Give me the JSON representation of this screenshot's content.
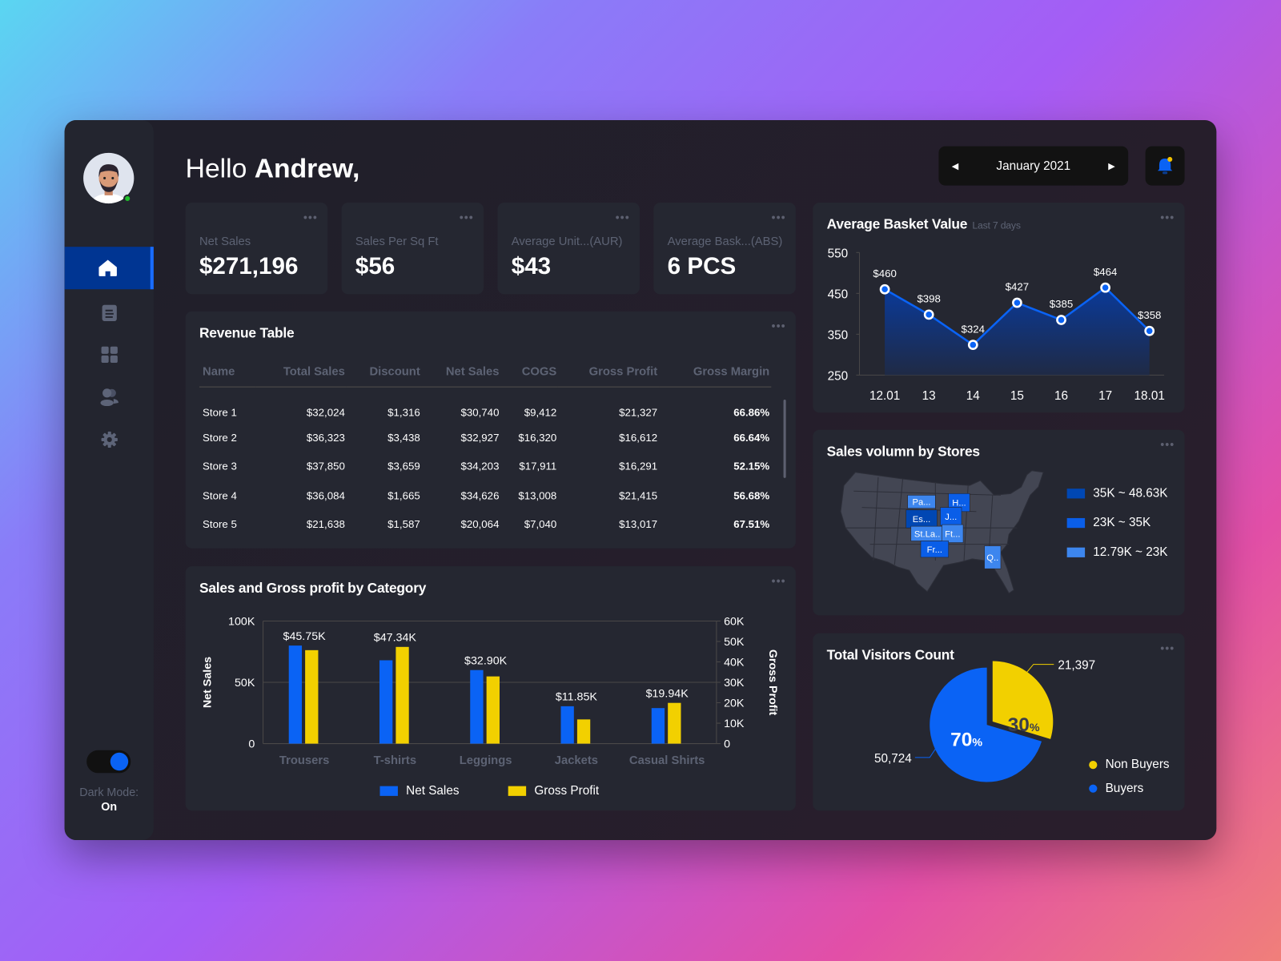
{
  "greeting": {
    "hello": "Hello",
    "name": "Andrew,"
  },
  "date_picker": {
    "label": "January 2021"
  },
  "sidebar": {
    "items": [
      {
        "icon": "home-icon",
        "active": true
      },
      {
        "icon": "document-icon"
      },
      {
        "icon": "grid-icon"
      },
      {
        "icon": "users-icon"
      },
      {
        "icon": "gear-icon"
      }
    ],
    "dark_mode_label": "Dark Mode:",
    "dark_mode_value": "On",
    "dark_mode_on": true
  },
  "kpis": [
    {
      "label": "Net Sales",
      "value": "$271,196"
    },
    {
      "label": "Sales Per Sq Ft",
      "value": "$56"
    },
    {
      "label": "Average Unit...(AUR)",
      "value": "$43"
    },
    {
      "label": "Average Bask...(ABS)",
      "value": "6 PCS"
    }
  ],
  "revenue_table": {
    "title": "Revenue Table",
    "columns": [
      "Name",
      "Total Sales",
      "Discount",
      "Net Sales",
      "COGS",
      "Gross Profit",
      "Gross Margin"
    ],
    "rows": [
      [
        "Store 1",
        "$32,024",
        "$1,316",
        "$30,740",
        "$9,412",
        "$21,327",
        "66.86%"
      ],
      [
        "Store 2",
        "$36,323",
        "$3,438",
        "$32,927",
        "$16,320",
        "$16,612",
        "66.64%"
      ],
      [
        "Store 3",
        "$37,850",
        "$3,659",
        "$34,203",
        "$17,911",
        "$16,291",
        "52.15%"
      ],
      [
        "Store 4",
        "$36,084",
        "$1,665",
        "$34,626",
        "$13,008",
        "$21,415",
        "56.68%"
      ],
      [
        "Store 5",
        "$21,638",
        "$1,587",
        "$20,064",
        "$7,040",
        "$13,017",
        "67.51%"
      ]
    ]
  },
  "colors": {
    "accent": "#0a63f5",
    "yellow": "#f2d000",
    "card": "#252731",
    "map_dark": "#0047b3",
    "map_mid": "#0a5ee8",
    "map_light": "#3d86ee"
  },
  "chart_data": [
    {
      "type": "bar",
      "title": "Sales and Gross profit by Category",
      "categories": [
        "Trousers",
        "T-shirts",
        "Leggings",
        "Jackets",
        "Casual Shirts"
      ],
      "series": [
        {
          "name": "Net Sales",
          "axis": "left",
          "values": [
            80000,
            68000,
            60000,
            30500,
            29000
          ]
        },
        {
          "name": "Gross Profit",
          "axis": "right",
          "values": [
            45750,
            47340,
            32900,
            11850,
            19940
          ]
        }
      ],
      "data_labels": [
        "$45.75K",
        "$47.34K",
        "$32.90K",
        "$11.85K",
        "$19.94K"
      ],
      "ylabel": "Net Sales",
      "ylim": [
        0,
        100000
      ],
      "yticks": [
        "0",
        "50K",
        "100K"
      ],
      "y2label": "Gross Profit",
      "y2lim": [
        0,
        60000
      ],
      "y2ticks": [
        "0",
        "10K",
        "20K",
        "30K",
        "40K",
        "50K",
        "60K"
      ],
      "legend": "bottom"
    },
    {
      "type": "area",
      "title": "Average Basket Value",
      "subtitle": "Last 7 days",
      "x": [
        "12.01",
        "13",
        "14",
        "15",
        "16",
        "17",
        "18.01"
      ],
      "values": [
        460,
        398,
        324,
        427,
        385,
        464,
        358
      ],
      "data_labels": [
        "$460",
        "$398",
        "$324",
        "$427",
        "$385",
        "$464",
        "$358"
      ],
      "ylim": [
        250,
        550
      ],
      "yticks": [
        "250",
        "350",
        "450",
        "550"
      ]
    },
    {
      "type": "pie",
      "title": "Total Visitors Count",
      "slices": [
        {
          "name": "Non Buyers",
          "value": 21397,
          "label": "21,397",
          "percent": "30",
          "color": "#f2d000"
        },
        {
          "name": "Buyers",
          "value": 50724,
          "label": "50,724",
          "percent": "70",
          "color": "#0a63f5"
        }
      ],
      "percent_sign": "%",
      "legend": "bottom-right"
    }
  ],
  "map": {
    "title": "Sales volumn by Stores",
    "regions": [
      {
        "label": "Pa...",
        "tier": 2
      },
      {
        "label": "H...",
        "tier": 1
      },
      {
        "label": "Es...",
        "tier": 0
      },
      {
        "label": "J...",
        "tier": 1
      },
      {
        "label": "St.La..",
        "tier": 2
      },
      {
        "label": "Ft...",
        "tier": 2
      },
      {
        "label": "Fr...",
        "tier": 1
      },
      {
        "label": "Q..",
        "tier": 2
      }
    ],
    "legend": [
      "35K ~ 48.63K",
      "23K ~ 35K",
      "12.79K ~ 23K"
    ]
  }
}
